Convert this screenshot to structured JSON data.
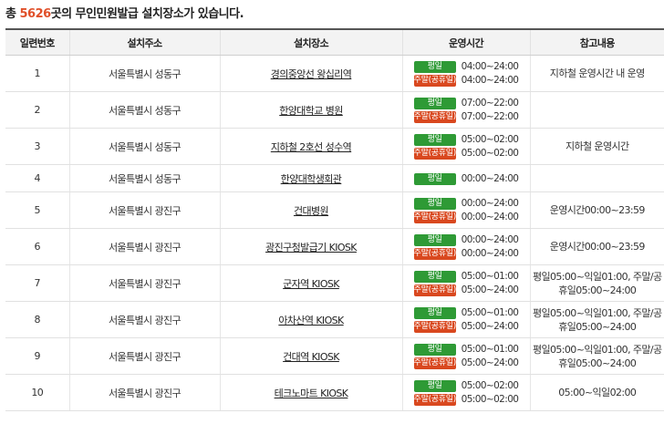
{
  "summary": {
    "prefix": "총 ",
    "count": "5626",
    "suffix": "곳의 무인민원발급 설치장소가 있습니다."
  },
  "columns": [
    "일련번호",
    "설치주소",
    "설치장소",
    "운영시간",
    "참고내용"
  ],
  "labels": {
    "weekday": "평일",
    "weekend": "주말(공휴일)"
  },
  "colors": {
    "weekday_badge": "#2e9a35",
    "weekend_badge": "#d9481f",
    "count": "#e0502a"
  },
  "rows": [
    {
      "no": "1",
      "address": "서울특별시 성동구",
      "place": "경의중앙선 왕십리역",
      "hours": [
        {
          "type": "weekday",
          "time": "04:00~24:00"
        },
        {
          "type": "weekend",
          "time": "04:00~24:00"
        }
      ],
      "note": "지하철 운영시간 내 운영"
    },
    {
      "no": "2",
      "address": "서울특별시 성동구",
      "place": "한양대학교 병원",
      "hours": [
        {
          "type": "weekday",
          "time": "07:00~22:00"
        },
        {
          "type": "weekend",
          "time": "07:00~22:00"
        }
      ],
      "note": ""
    },
    {
      "no": "3",
      "address": "서울특별시 성동구",
      "place": "지하철 2호선 성수역",
      "hours": [
        {
          "type": "weekday",
          "time": "05:00~02:00"
        },
        {
          "type": "weekend",
          "time": "05:00~02:00"
        }
      ],
      "note": "지하철 운영시간"
    },
    {
      "no": "4",
      "address": "서울특별시 성동구",
      "place": "한양대학생회관",
      "hours": [
        {
          "type": "weekday",
          "time": "00:00~24:00"
        }
      ],
      "note": ""
    },
    {
      "no": "5",
      "address": "서울특별시 광진구",
      "place": "건대병원",
      "hours": [
        {
          "type": "weekday",
          "time": "00:00~24:00"
        },
        {
          "type": "weekend",
          "time": "00:00~24:00"
        }
      ],
      "note": "운영시간00:00~23:59"
    },
    {
      "no": "6",
      "address": "서울특별시 광진구",
      "place": "광진구청발급기 KIOSK",
      "hours": [
        {
          "type": "weekday",
          "time": "00:00~24:00"
        },
        {
          "type": "weekend",
          "time": "00:00~24:00"
        }
      ],
      "note": "운영시간00:00~23:59"
    },
    {
      "no": "7",
      "address": "서울특별시 광진구",
      "place": "군자역 KIOSK",
      "hours": [
        {
          "type": "weekday",
          "time": "05:00~01:00"
        },
        {
          "type": "weekend",
          "time": "05:00~24:00"
        }
      ],
      "note": "평일05:00~익일01:00, 주말/공휴일05:00~24:00"
    },
    {
      "no": "8",
      "address": "서울특별시 광진구",
      "place": "아차산역 KIOSK",
      "hours": [
        {
          "type": "weekday",
          "time": "05:00~01:00"
        },
        {
          "type": "weekend",
          "time": "05:00~24:00"
        }
      ],
      "note": "평일05:00~익일01:00, 주말/공휴일05:00~24:00"
    },
    {
      "no": "9",
      "address": "서울특별시 광진구",
      "place": "건대역 KIOSK",
      "hours": [
        {
          "type": "weekday",
          "time": "05:00~01:00"
        },
        {
          "type": "weekend",
          "time": "05:00~24:00"
        }
      ],
      "note": "평일05:00~익일01:00, 주말/공휴일05:00~24:00"
    },
    {
      "no": "10",
      "address": "서울특별시 광진구",
      "place": "테크노마트 KIOSK",
      "hours": [
        {
          "type": "weekday",
          "time": "05:00~02:00"
        },
        {
          "type": "weekend",
          "time": "05:00~02:00"
        }
      ],
      "note": "05:00~익일02:00"
    }
  ]
}
